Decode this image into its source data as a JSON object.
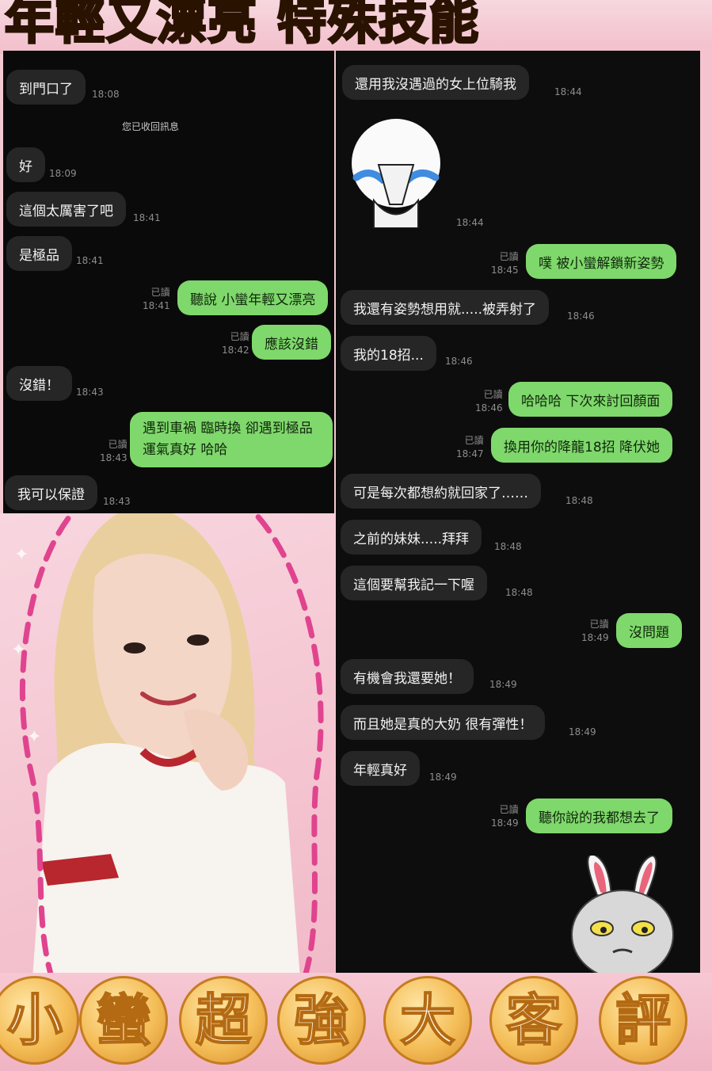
{
  "banner": {
    "title_a": "年輕又漂亮",
    "title_b": "特殊技能"
  },
  "left_chat": [
    {
      "side": "in",
      "text": "到門口了",
      "time": "18:08"
    },
    {
      "side": "notice",
      "text": "您已收回訊息"
    },
    {
      "side": "in",
      "text": "好",
      "time": "18:09"
    },
    {
      "side": "in",
      "text": "這個太厲害了吧",
      "time": "18:41"
    },
    {
      "side": "in",
      "text": "是極品",
      "time": "18:41"
    },
    {
      "side": "out",
      "text": "聽說 小蠻年輕又漂亮",
      "read": "已讀",
      "time": "18:41"
    },
    {
      "side": "out",
      "text": "應該沒錯",
      "read": "已讀",
      "time": "18:42"
    },
    {
      "side": "in",
      "text": "沒錯！",
      "time": "18:43"
    },
    {
      "side": "out",
      "text": "遇到車禍 臨時換 卻遇到極品 運氣真好 哈哈",
      "read": "已讀",
      "time": "18:43"
    },
    {
      "side": "in",
      "text": "我可以保證",
      "time": "18:43"
    }
  ],
  "right_chat": [
    {
      "side": "in",
      "text": "還用我沒遇過的女上位騎我",
      "time": "18:44"
    },
    {
      "side": "sticker",
      "icon": "crying-bear-sticker-icon",
      "time": "18:44"
    },
    {
      "side": "out",
      "text": "噗 被小蠻解鎖新姿勢",
      "read": "已讀",
      "time": "18:45"
    },
    {
      "side": "in",
      "text": "我還有姿勢想用就.....被弄射了",
      "time": "18:46"
    },
    {
      "side": "in",
      "text": "我的18招...",
      "time": "18:46"
    },
    {
      "side": "out",
      "text": "哈哈哈 下次來討回顏面",
      "read": "已讀",
      "time": "18:46"
    },
    {
      "side": "out",
      "text": "換用你的降龍18招 降伏她",
      "read": "已讀",
      "time": "18:47"
    },
    {
      "side": "in",
      "text": "可是每次都想約就回家了……",
      "time": "18:48"
    },
    {
      "side": "in",
      "text": "之前的妹妹.....拜拜",
      "time": "18:48"
    },
    {
      "side": "in",
      "text": "這個要幫我記一下喔",
      "time": "18:48"
    },
    {
      "side": "out",
      "text": "沒問題",
      "read": "已讀",
      "time": "18:49"
    },
    {
      "side": "in",
      "text": "有機會我還要她！",
      "time": "18:49"
    },
    {
      "side": "in",
      "text": "而且她是真的大奶 很有彈性！",
      "time": "18:49"
    },
    {
      "side": "in",
      "text": "年輕真好",
      "time": "18:49"
    },
    {
      "side": "out",
      "text": "聽你說的我都想去了",
      "read": "已讀",
      "time": "18:49"
    },
    {
      "side": "sticker",
      "icon": "bunny-sticker-icon"
    }
  ],
  "bottom_banner": [
    "小",
    "蠻",
    "超",
    "強",
    "大",
    "客",
    "評"
  ],
  "colors": {
    "outgoing_bubble": "#7fd86b",
    "incoming_bubble": "#262626",
    "chat_background": "#0a0a0a",
    "frame_pink": "#f5c9d2"
  }
}
